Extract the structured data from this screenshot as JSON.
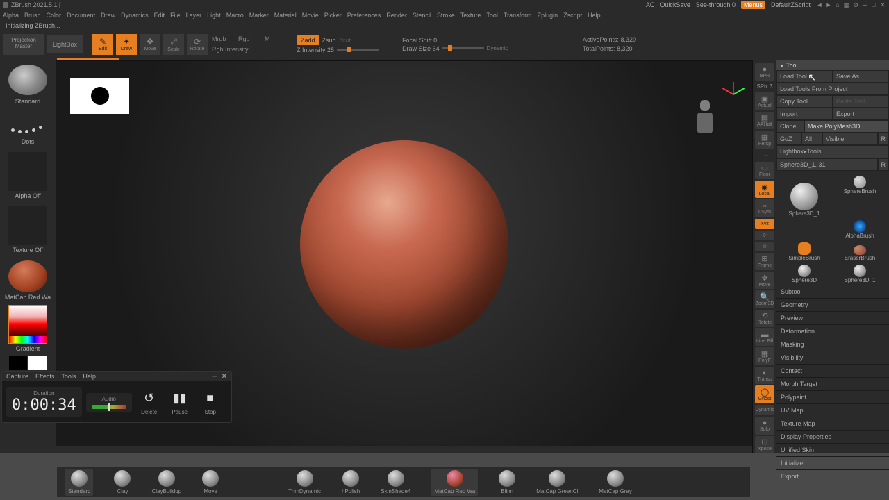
{
  "titlebar": {
    "title": "ZBrush 2021.5.1 [",
    "ac": "AC",
    "quicksave": "QuickSave",
    "seethrough": "See-through 0",
    "menus": "Menus",
    "script": "DefaultZScript"
  },
  "menubar": [
    "Alpha",
    "Brush",
    "Color",
    "Document",
    "Draw",
    "Dynamics",
    "Edit",
    "File",
    "Layer",
    "Light",
    "Macro",
    "Marker",
    "Material",
    "Movie",
    "Picker",
    "Preferences",
    "Render",
    "Stencil",
    "Stroke",
    "Texture",
    "Tool",
    "Transform",
    "Zplugin",
    "Zscript",
    "Help"
  ],
  "status": "Initializing ZBrush...",
  "toolbar": {
    "proj_master": "Projection Master",
    "lightbox": "LightBox",
    "edit": "Edit",
    "draw": "Draw",
    "move": "Move",
    "scale": "Scale",
    "rotate": "Rotate",
    "mrgb": "Mrgb",
    "rgb": "Rgb",
    "m": "M",
    "rgb_intensity": "Rgb Intensity",
    "zadd": "Zadd",
    "zsub": "Zsub",
    "zcut": "Zcut",
    "zintensity": "Z Intensity 25",
    "focal": "Focal Shift 0",
    "drawsize": "Draw Size 64",
    "dynamic": "Dynamic",
    "active_points": "ActivePoints: 8,320",
    "total_points": "TotalPoints: 8,320"
  },
  "left": {
    "brush": "Standard",
    "stroke": "Dots",
    "alpha": "Alpha Off",
    "texture": "Texture Off",
    "material": "MatCap Red Wa",
    "gradient": "Gradient",
    "switchcolor": "SwitchColor"
  },
  "right_icons": {
    "bpr": "BPR",
    "spix": "SPix 3",
    "actual": "Actual",
    "aahalf": "AAHalf",
    "persp": "Persp",
    "floor": "Floor",
    "local": "Local",
    "lsym": "LSym",
    "xyz": "Xyz",
    "frame": "Frame",
    "move": "Move",
    "zoom3d": "Zoom3D",
    "rotate": "Rotate",
    "linefill": "Line Fill",
    "polyf": "PolyF",
    "transp": "Transp",
    "ghost": "Ghost",
    "dynamic": "Dynamic",
    "solo": "Solo",
    "xpose": "Xpose"
  },
  "right_panel": {
    "header": "Tool",
    "load_tool": "Load Tool",
    "save_as": "Save As",
    "load_proj": "Load Tools From Project",
    "copy_tool": "Copy Tool",
    "paste_tool": "Paste Tool",
    "import": "Import",
    "export": "Export",
    "clone": "Clone",
    "make_polymesh": "Make PolyMesh3D",
    "goz": "GoZ",
    "all": "All",
    "visible": "Visible",
    "r": "R",
    "lightbox_tools": "Lightbox▸Tools",
    "tool_name": "Sphere3D_1. 31",
    "tools": [
      {
        "name": "Sphere3D_1"
      },
      {
        "name": "SphereBrush"
      },
      {
        "name": "SimpleBrush"
      },
      {
        "name": "AlphaBrush"
      },
      {
        "name": "EraserBrush"
      },
      {
        "name": "Sphere3D"
      },
      {
        "name": "Sphere3D_1"
      }
    ],
    "sections": [
      "Subtool",
      "Geometry",
      "Preview",
      "Deformation",
      "Masking",
      "Visibility",
      "Contact",
      "Morph Target",
      "Polypaint",
      "UV Map",
      "Texture Map",
      "Display Properties",
      "Unified Skin",
      "Initialize",
      "Export"
    ]
  },
  "recorder": {
    "menus": [
      "Capture",
      "Effects",
      "Tools",
      "Help"
    ],
    "duration_lbl": "Duration",
    "duration": "0:00:34",
    "audio_lbl": "Audio",
    "delete": "Delete",
    "pause": "Pause",
    "stop": "Stop"
  },
  "bottom_brushes": [
    "Standard",
    "Clay",
    "ClayBuildup",
    "Move",
    "",
    "TrimDynamic",
    "hPolish",
    "SkinShade4",
    "MatCap Red Wa",
    "Blinn",
    "MatCap GreenCl",
    "MatCap Gray"
  ]
}
